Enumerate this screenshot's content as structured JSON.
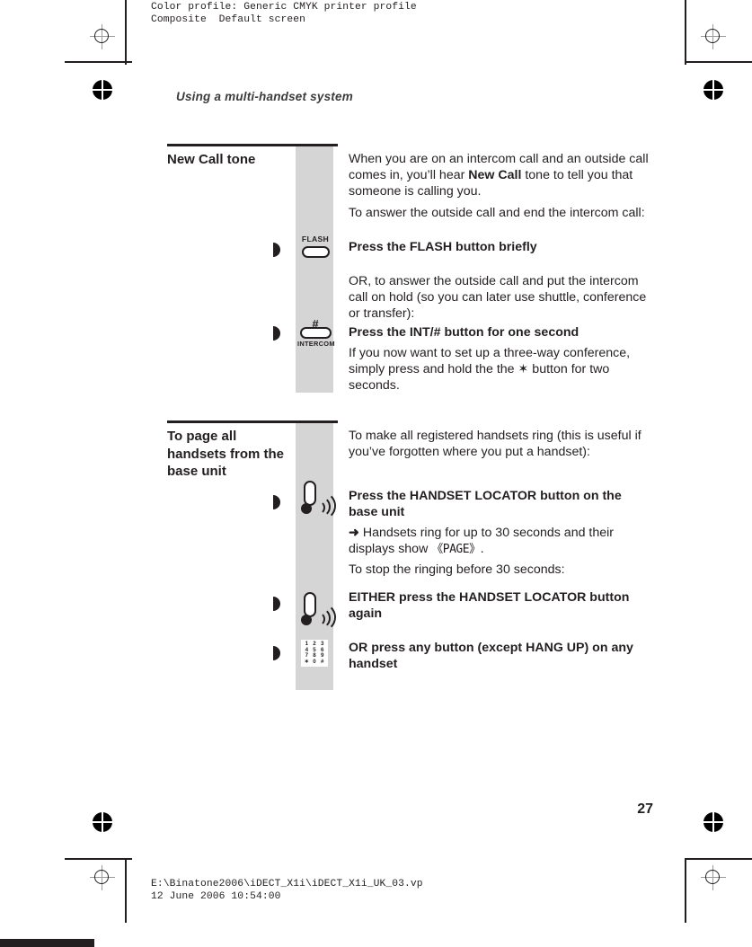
{
  "prepress": {
    "color_profile_line1": "Color profile: Generic CMYK printer profile",
    "color_profile_line2": "Composite  Default screen",
    "footer_line1": "E:\\Binatone2006\\iDECT_X1i\\iDECT_X1i_UK_03.vp",
    "footer_line2": "12 June 2006 10:54:00"
  },
  "page": {
    "running_head": "Using a multi-handset system",
    "page_number": "27"
  },
  "sections": [
    {
      "title": "New Call tone",
      "paragraphs": [
        {
          "id": "p1",
          "html": "When you are on an intercom call and an outside call comes in, you’ll hear <b>New Call</b> tone to tell you that someone is calling you."
        },
        {
          "id": "p2",
          "html": "To answer the outside call and end the intercom call:"
        },
        {
          "id": "p3",
          "html": "Press the FLASH button briefly",
          "bold": true
        },
        {
          "id": "p4",
          "html": "OR, to answer the outside call and put the intercom call on hold (so you can later use shuttle, conference or transfer):"
        },
        {
          "id": "p5",
          "html": "Press the <b>INT/#</b> button for one second",
          "bold": true
        },
        {
          "id": "p6",
          "html": "If you now want to set up a three-way conference, simply press and hold the the ✶ button for two seconds."
        }
      ],
      "icons": [
        {
          "name": "flash-button-icon",
          "label": "FLASH"
        },
        {
          "name": "intercom-hash-button-icon",
          "label": "INTERCOM",
          "glyph": "#"
        }
      ]
    },
    {
      "title": "To page all handsets from the base unit",
      "paragraphs": [
        {
          "id": "q1",
          "html": "To make all registered handsets ring (this is useful if you’ve forgotten where you put a handset):"
        },
        {
          "id": "q2",
          "html": "Press the <b>HANDSET LOCATOR</b> button on the base unit",
          "bold": true
        },
        {
          "id": "q3",
          "html": "<span class=\"arrow-glyph\">➜</span> Handsets ring for up to 30 seconds and their displays show <span class=\"lcd\">《PAGE》</span>."
        },
        {
          "id": "q4",
          "html": "To stop the ringing before 30 seconds:"
        },
        {
          "id": "q5",
          "html": "EITHER press the <b>HANDSET LOCATOR</b> button again",
          "bold": true
        },
        {
          "id": "q6",
          "html": "OR press any button (except HANG UP) on any handset",
          "bold": true
        }
      ],
      "icons": [
        {
          "name": "handset-locator-icon"
        },
        {
          "name": "handset-locator-icon"
        },
        {
          "name": "keypad-icon",
          "keys": [
            "1",
            "2",
            "3",
            "4",
            "5",
            "6",
            "7",
            "8",
            "9",
            "✶",
            "0",
            "#"
          ]
        }
      ]
    }
  ],
  "colors": {
    "ink": "#231f20",
    "art_panel": "#d5d5d5",
    "running_head": "#3b3b3b"
  }
}
